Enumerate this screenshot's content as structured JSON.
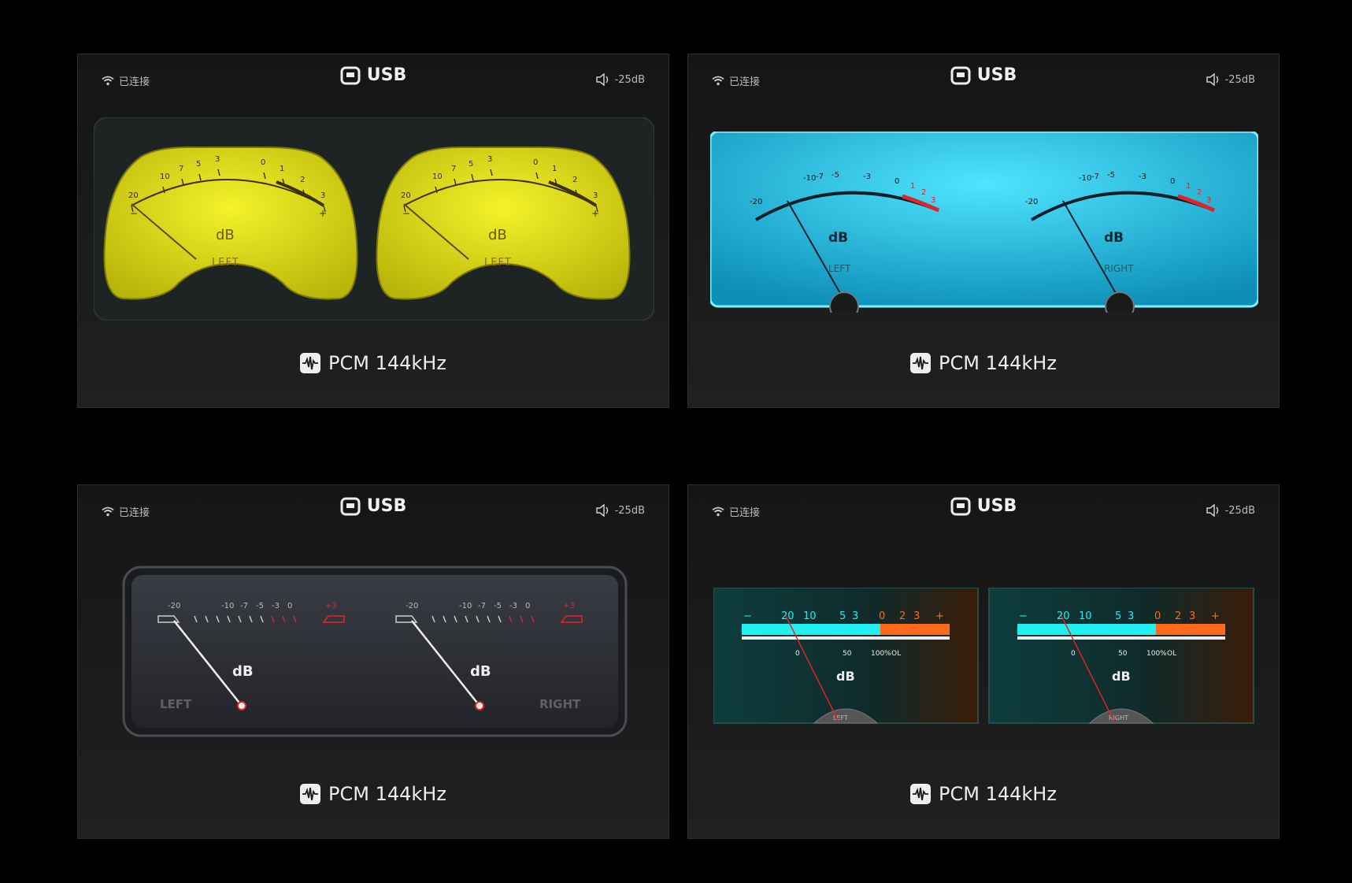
{
  "status": {
    "connection": "已连接",
    "source": "USB",
    "volume": "-25dB"
  },
  "format": "PCM 144kHz",
  "meter_labels": {
    "unit": "dB",
    "left": "LEFT",
    "right": "RIGHT"
  },
  "scales": {
    "yellow": [
      "20",
      "10",
      "7",
      "5",
      "3",
      "0",
      "1",
      "2",
      "3"
    ],
    "yellow_ends": [
      "−",
      "+"
    ],
    "blue": [
      "-20",
      "-10",
      "-7",
      "-5",
      "-3",
      "0",
      "1",
      "2",
      "3"
    ],
    "grey": [
      "-20",
      "-10",
      "-7",
      "-5",
      "-3",
      "0",
      "+3"
    ],
    "teal_top": [
      "−",
      "20",
      "10",
      "5",
      "3",
      "0",
      "2",
      "3",
      "+"
    ],
    "teal_bottom": [
      "0",
      "50",
      "100%",
      "OL"
    ]
  },
  "colors": {
    "yellow": "#e8e41a",
    "cyan": "#2fd2f2",
    "red": "#e0242a",
    "orange": "#ff6a1a",
    "teal": "#20f0f0"
  },
  "icons": [
    "wifi-icon",
    "usb-icon",
    "speaker-icon",
    "waveform-icon"
  ]
}
